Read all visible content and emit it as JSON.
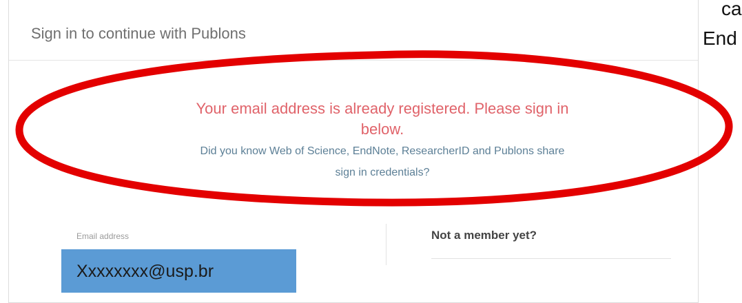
{
  "card": {
    "title": "Sign in to continue with Publons"
  },
  "alert": {
    "error_line1": "Your email address is already registered. Please sign in",
    "error_line2": "below.",
    "info_line1": "Did you know Web of Science, EndNote, ResearcherID and Publons share",
    "info_line2": "sign in credentials?"
  },
  "form": {
    "email_label": "Email address",
    "email_value": "Xxxxxxxx@usp.br"
  },
  "signup": {
    "heading": "Not a member yet?"
  },
  "corner": {
    "line1": "ca",
    "line2": "End"
  },
  "colors": {
    "error": "#e0636a",
    "info": "#5c7f96",
    "annotation": "#e30000",
    "email_highlight": "#5b9bd5"
  }
}
